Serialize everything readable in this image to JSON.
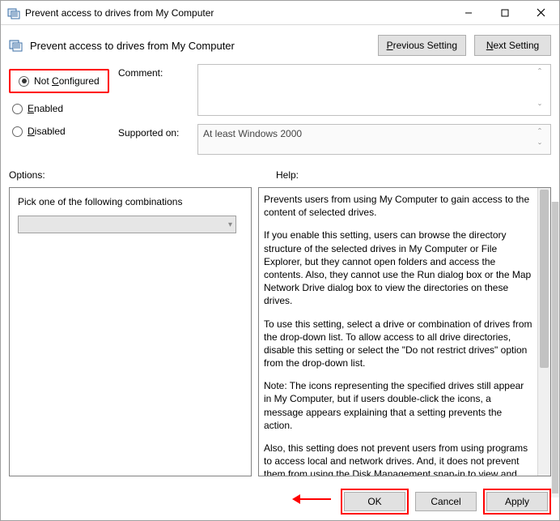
{
  "window": {
    "title": "Prevent access to drives from My Computer"
  },
  "header": {
    "heading": "Prevent access to drives from My Computer",
    "prev_label": "Previous Setting",
    "next_label": "Next Setting"
  },
  "radios": {
    "not_configured": "Not Configured",
    "enabled": "Enabled",
    "disabled": "Disabled",
    "selected": "not_configured"
  },
  "labels": {
    "comment": "Comment:",
    "supported": "Supported on:",
    "options": "Options:",
    "help": "Help:"
  },
  "supported_text": "At least Windows 2000",
  "options": {
    "prompt": "Pick one of the following combinations",
    "selected_value": ""
  },
  "help": {
    "p1": "Prevents users from using My Computer to gain access to the content of selected drives.",
    "p2": "If you enable this setting, users can browse the directory structure of the selected drives in My Computer or File Explorer, but they cannot open folders and access the contents. Also, they cannot use the Run dialog box or the Map Network Drive dialog box to view the directories on these drives.",
    "p3": "To use this setting, select a drive or combination of drives from the drop-down list. To allow access to all drive directories, disable this setting or select the \"Do not restrict drives\" option from the drop-down list.",
    "p4": "Note: The icons representing the specified drives still appear in My Computer, but if users double-click the icons, a message appears explaining that a setting prevents the action.",
    "p5": " Also, this setting does not prevent users from using programs to access local and network drives. And, it does not prevent them from using the Disk Management snap-in to view and change"
  },
  "footer": {
    "ok": "OK",
    "cancel": "Cancel",
    "apply": "Apply"
  },
  "colors": {
    "highlight": "#ff0000"
  }
}
